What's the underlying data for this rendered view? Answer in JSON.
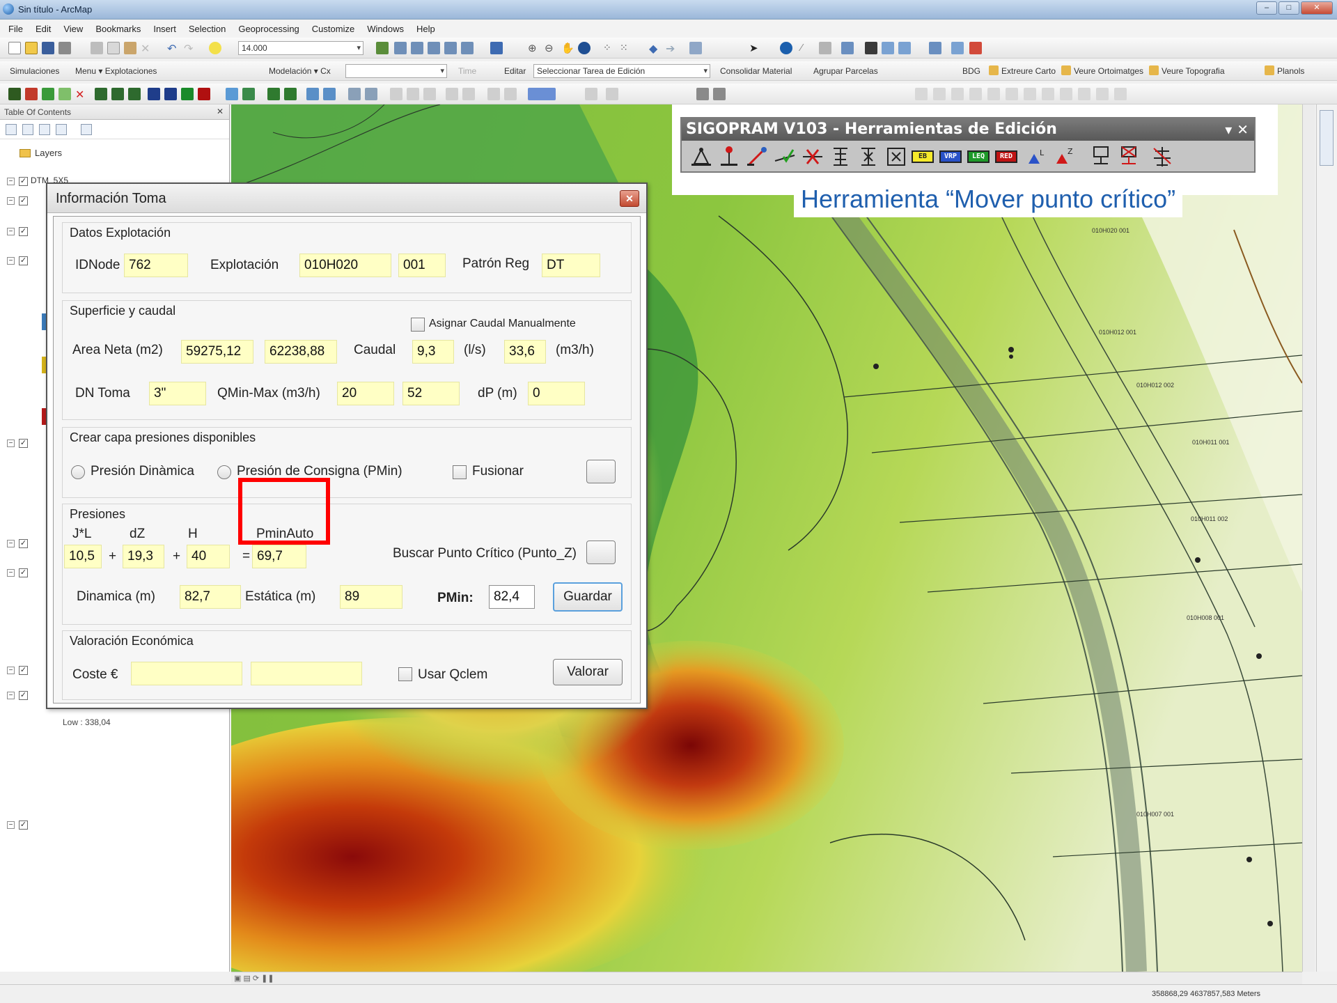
{
  "window": {
    "title": "Sin título - ArcMap"
  },
  "menu": [
    "File",
    "Edit",
    "View",
    "Bookmarks",
    "Insert",
    "Selection",
    "Geoprocessing",
    "Customize",
    "Windows",
    "Help"
  ],
  "toolbar": {
    "scale": "14.000",
    "simulaciones": "Simulaciones",
    "menu_explotaciones": "Menu ▾ Explotaciones",
    "modelacion": "Modelación ▾ Cx",
    "time": "Time",
    "editar": "Editar",
    "seleccionar_tarea": "Seleccionar Tarea de Edición",
    "consolidar": "Consolidar Material",
    "agrupar": "Agrupar Parcelas",
    "bdg": "BDG",
    "extreure": "Extreure Carto",
    "veure_ortoimatges": "Veure Ortoimatges",
    "veure_topografia": "Veure Topografia",
    "planols": "Planols"
  },
  "toc": {
    "title": "Table Of Contents",
    "layers_label": "Layers",
    "dtm_label": "DTM_5X5",
    "low_label": "Low : 338,04"
  },
  "sigopram": {
    "title": "SIGOPRAM V103 - Herramientas de Edición",
    "badges": [
      "EB",
      "VRP",
      "LEQ",
      "RED"
    ],
    "callout": "Herramienta “Mover punto crítico”"
  },
  "map_labels": [
    "010H020 001",
    "010H012 001",
    "010H012 002",
    "010H011 001",
    "010H011 002",
    "010H008 001",
    "010H007 001"
  ],
  "status": {
    "coords": "358868,29 4637857,583 Meters"
  },
  "dialog": {
    "title": "Información Toma",
    "close_icon": "close-icon",
    "datos": {
      "title": "Datos Explotación",
      "idnode_label": "IDNode",
      "idnode_value": "762",
      "explotacion_label": "Explotación",
      "explotacion_value": "010H020",
      "explotacion_suffix": "001",
      "patron_label": "Patrón Reg",
      "patron_value": "DT"
    },
    "superficie": {
      "title": "Superficie y caudal",
      "asignar_label": "Asignar Caudal Manualmente",
      "area_label": "Area Neta (m2)",
      "area1": "59275,12",
      "area2": "62238,88",
      "caudal_label": "Caudal",
      "caudal_ls": "9,3",
      "ls_unit": "(l/s)",
      "caudal_m3h": "33,6",
      "m3h_unit": "(m3/h)",
      "dn_label": "DN Toma",
      "dn_value": "3\"",
      "qminmax_label": "QMin-Max (m3/h)",
      "qmin": "20",
      "qmax": "52",
      "dp_label": "dP (m)",
      "dp_value": "0"
    },
    "capa": {
      "title": "Crear capa presiones disponibles",
      "radio1": "Presión Dinàmica",
      "radio2": "Presión de Consigna (PMin)",
      "fusionar": "Fusionar"
    },
    "presiones": {
      "title": "Presiones",
      "jl_label": "J*L",
      "dz_label": "dZ",
      "h_label": "H",
      "pmin_auto_label": "PminAuto",
      "jl": "10,5",
      "plus1": "+",
      "dz": "19,3",
      "plus2": "+",
      "h": "40",
      "eq": "=",
      "pmin_auto": "69,7",
      "buscar_label": "Buscar Punto Crítico (Punto_Z)",
      "dinamica_label": "Dinamica (m)",
      "dinamica": "82,7",
      "estatica_label": "Estática (m)",
      "estatica": "89",
      "pmin_label": "PMin:",
      "pmin": "82,4",
      "guardar": "Guardar"
    },
    "valoracion": {
      "title": "Valoración Económica",
      "coste_label": "Coste €",
      "coste1": "",
      "coste2": "",
      "usar_qclem": "Usar Qclem",
      "valorar": "Valorar"
    }
  }
}
